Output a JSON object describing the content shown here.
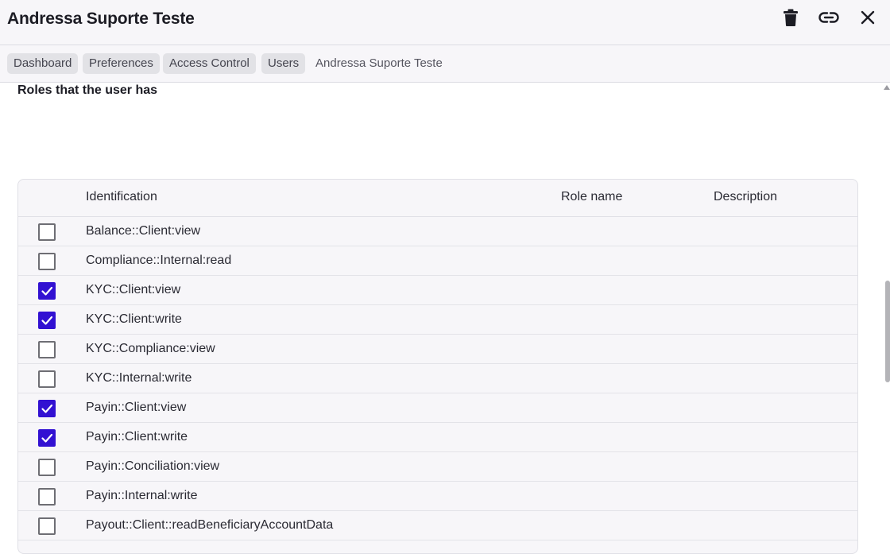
{
  "header": {
    "title": "Andressa Suporte Teste",
    "icons": [
      "trash-icon",
      "link-icon",
      "close-icon"
    ]
  },
  "breadcrumb": {
    "items": [
      "Dashboard",
      "Preferences",
      "Access Control",
      "Users"
    ],
    "current": "Andressa Suporte Teste"
  },
  "section": {
    "title": "Roles that the user has"
  },
  "table": {
    "columns": {
      "identification": "Identification",
      "role_name": "Role name",
      "description": "Description"
    },
    "rows": [
      {
        "identification": "Balance::Client:view",
        "checked": false
      },
      {
        "identification": "Compliance::Internal:read",
        "checked": false
      },
      {
        "identification": "KYC::Client:view",
        "checked": true
      },
      {
        "identification": "KYC::Client:write",
        "checked": true
      },
      {
        "identification": "KYC::Compliance:view",
        "checked": false
      },
      {
        "identification": "KYC::Internal:write",
        "checked": false
      },
      {
        "identification": "Payin::Client:view",
        "checked": true
      },
      {
        "identification": "Payin::Client:write",
        "checked": true
      },
      {
        "identification": "Payin::Conciliation:view",
        "checked": false
      },
      {
        "identification": "Payin::Internal:write",
        "checked": false
      },
      {
        "identification": "Payout::Client::readBeneficiaryAccountData",
        "checked": false
      }
    ]
  },
  "colors": {
    "accent": "#3211d2",
    "header_bg": "#f7f6f9",
    "crumb_bg": "#e2e2e6"
  }
}
